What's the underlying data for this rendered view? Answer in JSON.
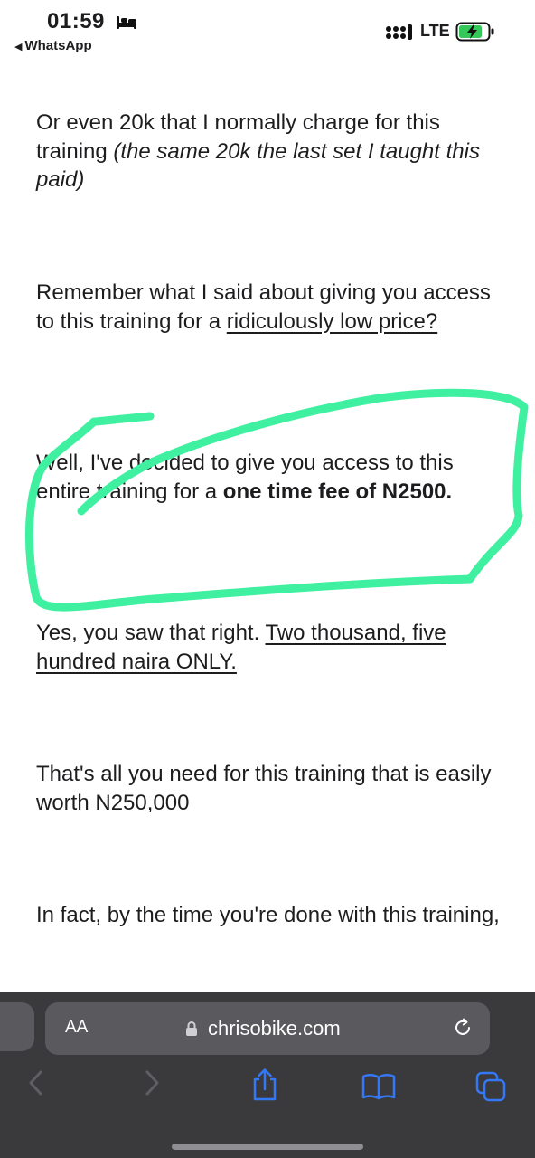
{
  "status_bar": {
    "time": "01:59",
    "back_app": "WhatsApp",
    "network": "LTE"
  },
  "content": {
    "p1_plain": "Or even 20k that I normally charge for this training ",
    "p1_italic": "(the same 20k the last set I taught this paid)",
    "p2_plain": "Remember what I said about giving you access to this training for a ",
    "p2_underlined": "ridiculously low price?",
    "p3_plain": "Well, I've decided to give you access to this entire training  for a ",
    "p3_bold": "one time fee of N2500.",
    "p4_plain": "Yes, you saw that right. ",
    "p4_underlined": " Two thousand, five hundred naira ONLY.",
    "p5": "That's all you need for this training that is easily worth N250,000",
    "p6": "In fact, by the time you're done with this training,"
  },
  "browser": {
    "text_size_label": "AA",
    "url": "chrisobike.com",
    "accent_color": "#3478f6"
  },
  "annotation": {
    "color": "#3ff0a0"
  }
}
